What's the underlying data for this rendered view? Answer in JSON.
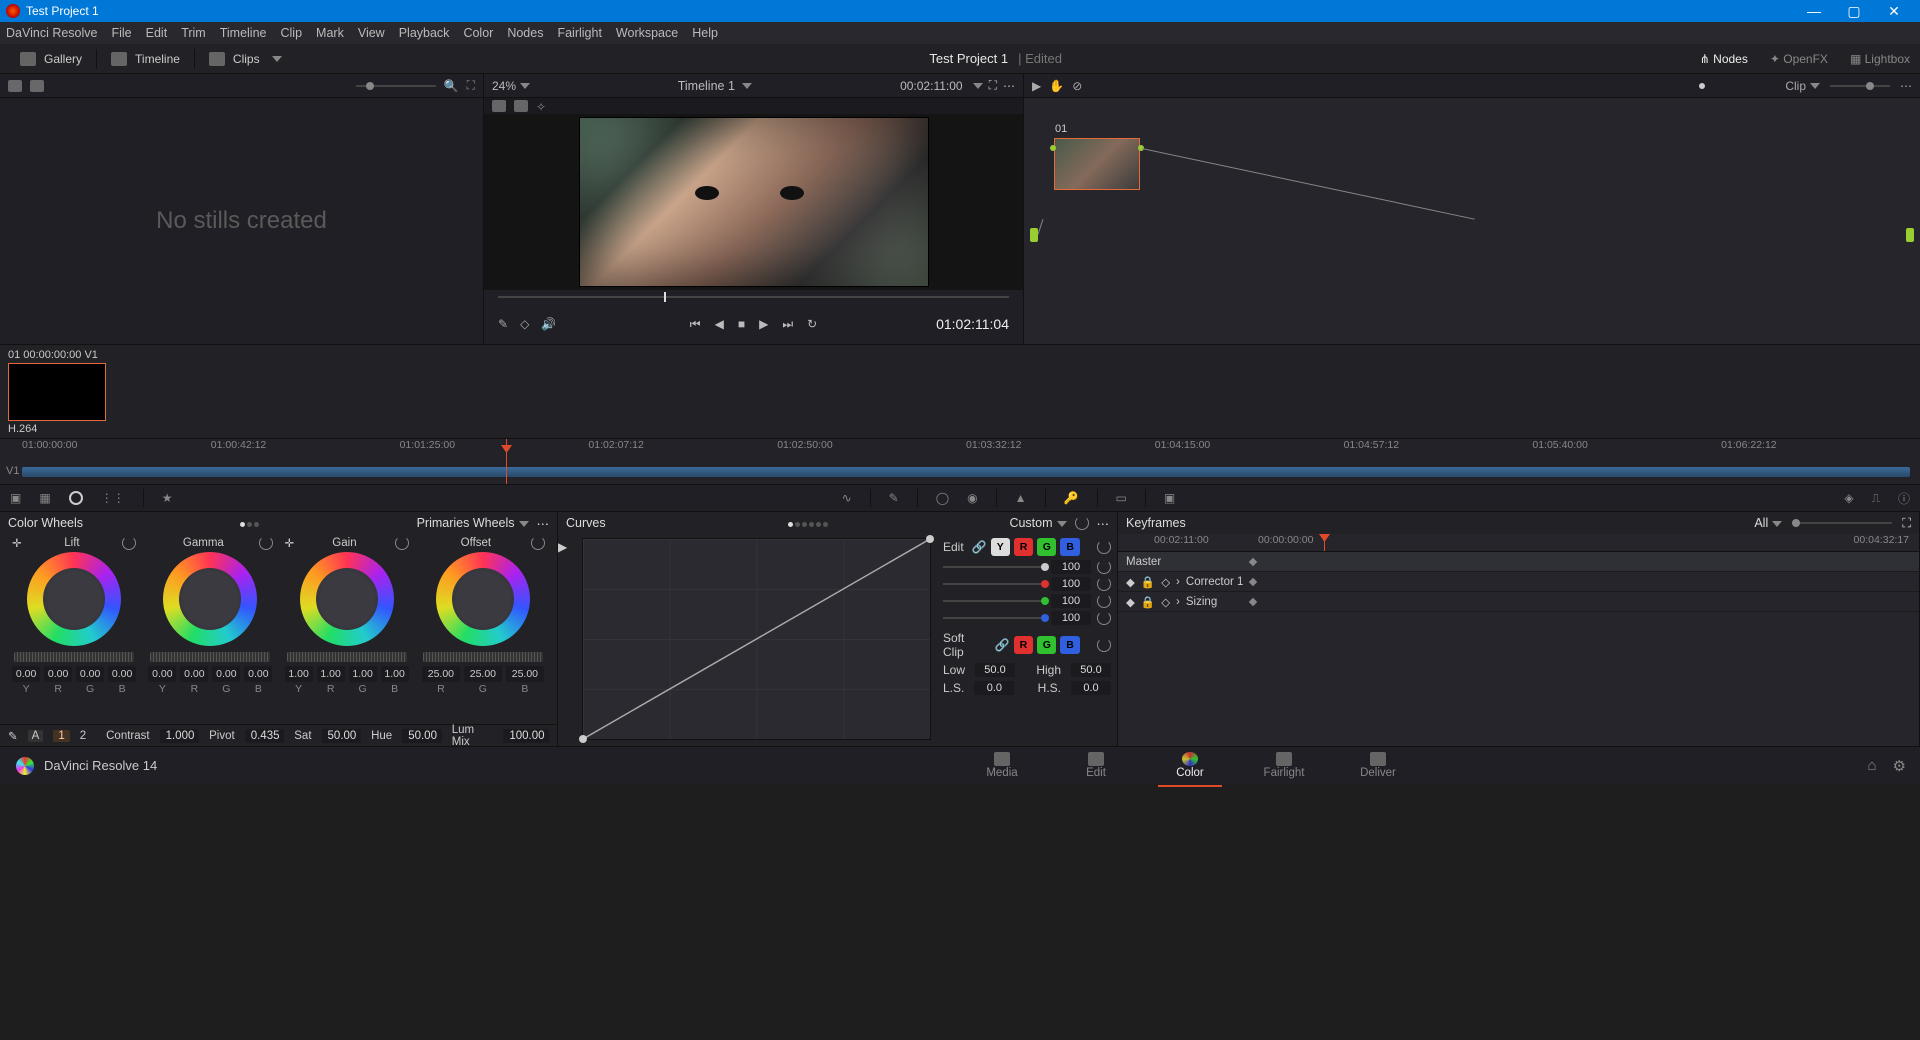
{
  "title": "Test Project 1",
  "menubar": [
    "DaVinci Resolve",
    "File",
    "Edit",
    "Trim",
    "Timeline",
    "Clip",
    "Mark",
    "View",
    "Playback",
    "Color",
    "Nodes",
    "Fairlight",
    "Workspace",
    "Help"
  ],
  "secondbar": {
    "gallery": "Gallery",
    "timeline": "Timeline",
    "clips": "Clips",
    "project": "Test Project 1",
    "edited": "Edited",
    "nodes": "Nodes",
    "openfx": "OpenFX",
    "lightbox": "Lightbox"
  },
  "gallery": {
    "empty": "No stills created"
  },
  "viewer": {
    "zoom": "24%",
    "timeline": "Timeline 1",
    "tc_in": "00:02:11:00",
    "tc_cur": "01:02:11:04"
  },
  "nodes": {
    "clip": "Clip",
    "n01": "01"
  },
  "clip": {
    "head": "01   00:00:00:00    V1",
    "codec": "H.264"
  },
  "timeline": {
    "marks": [
      "01:00:00:00",
      "01:00:42:12",
      "01:01:25:00",
      "01:02:07:12",
      "01:02:50:00",
      "01:03:32:12",
      "01:04:15:00",
      "01:04:57:12",
      "01:05:40:00",
      "01:06:22:12"
    ],
    "v1": "V1"
  },
  "wheels": {
    "title": "Color Wheels",
    "mode": "Primaries Wheels",
    "labels": [
      "Lift",
      "Gamma",
      "Gain",
      "Offset"
    ],
    "vals_lgg": [
      "0.00",
      "0.00",
      "0.00",
      "0.00"
    ],
    "vals_gain": [
      "1.00",
      "1.00",
      "1.00",
      "1.00"
    ],
    "vals_off": [
      "25.00",
      "25.00",
      "25.00"
    ],
    "ch": [
      "Y",
      "R",
      "G",
      "B"
    ],
    "ch3": [
      "R",
      "G",
      "B"
    ],
    "contrast_l": "Contrast",
    "contrast": "1.000",
    "pivot_l": "Pivot",
    "pivot": "0.435",
    "sat_l": "Sat",
    "sat": "50.00",
    "hue_l": "Hue",
    "hue": "50.00",
    "lum_l": "Lum Mix",
    "lum": "100.00",
    "page1": "1",
    "page2": "2"
  },
  "curves": {
    "title": "Curves",
    "mode": "Custom",
    "edit": "Edit",
    "soft": "Soft Clip",
    "low_l": "Low",
    "low": "50.0",
    "high_l": "High",
    "high": "50.0",
    "ls_l": "L.S.",
    "ls": "0.0",
    "hs_l": "H.S.",
    "hs": "0.0",
    "v100": "100"
  },
  "keyframes": {
    "title": "Keyframes",
    "all": "All",
    "tc_cur": "00:02:11:00",
    "tc_start": "00:00:00:00",
    "tc_end": "00:04:32:17",
    "master": "Master",
    "rows": [
      "Corrector 1",
      "Sizing"
    ]
  },
  "pagebar": {
    "app": "DaVinci Resolve 14",
    "pages": [
      "Media",
      "Edit",
      "Color",
      "Fairlight",
      "Deliver"
    ],
    "active": "Color"
  }
}
